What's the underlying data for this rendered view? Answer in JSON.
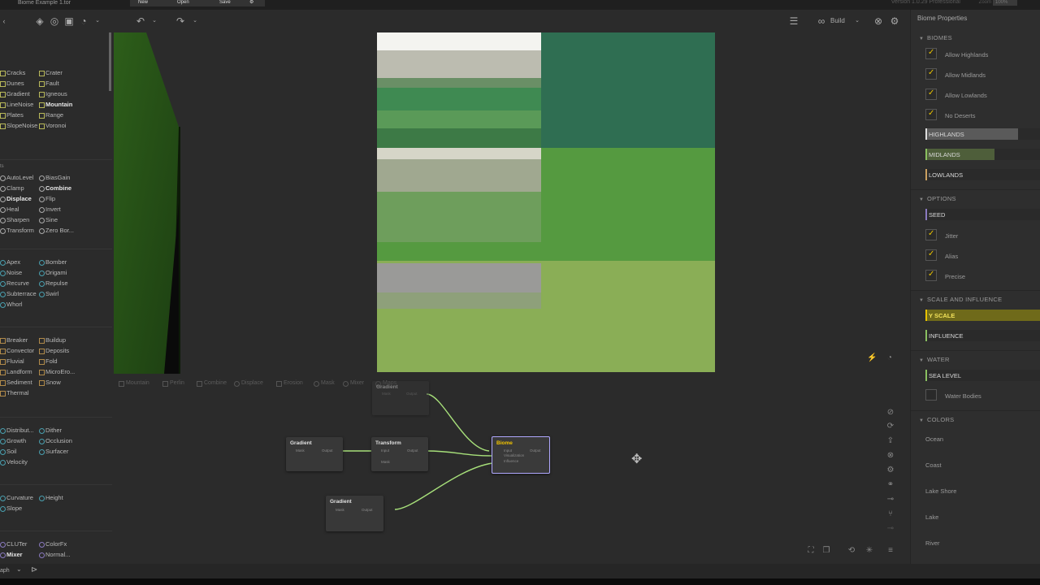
{
  "titlebar": {
    "document_tab": "Biome Example 1.tor",
    "menu": {
      "new": "New",
      "open": "Open",
      "save": "Save"
    },
    "version": "Version 1.0.29 Professional",
    "zoom_label": "Zoom",
    "zoom_value": "100%"
  },
  "toolbar": {
    "build_label": "Build"
  },
  "library": {
    "sections": [
      {
        "header": "",
        "items": [
          {
            "label": "Cracks",
            "style": "sq-y"
          },
          {
            "label": "Crater",
            "style": "sq-y"
          },
          {
            "label": "Dunes",
            "style": "sq-y"
          },
          {
            "label": "Fault",
            "style": "sq-y"
          },
          {
            "label": "Gradient",
            "style": "sq-y"
          },
          {
            "label": "Igneous",
            "style": "sq-y"
          },
          {
            "label": "LineNoise",
            "style": "sq-y"
          },
          {
            "label": "Mountain",
            "style": "sq-y",
            "bold": true
          },
          {
            "label": "Plates",
            "style": "sq-y"
          },
          {
            "label": "Range",
            "style": "sq-y"
          },
          {
            "label": "SlopeNoise",
            "style": "sq-y"
          },
          {
            "label": "Voronoi",
            "style": "sq-y"
          }
        ]
      },
      {
        "header": "ts",
        "items": [
          {
            "label": "AutoLevel",
            "style": "sl-w"
          },
          {
            "label": "BiasGain",
            "style": "sl-w"
          },
          {
            "label": "Clamp",
            "style": "sl-w"
          },
          {
            "label": "Combine",
            "style": "sl-w",
            "bold": true
          },
          {
            "label": "Displace",
            "style": "sl-w",
            "bold": true
          },
          {
            "label": "Flip",
            "style": "sl-w"
          },
          {
            "label": "Heal",
            "style": "sl-w"
          },
          {
            "label": "Invert",
            "style": "sl-w"
          },
          {
            "label": "Sharpen",
            "style": "sl-w"
          },
          {
            "label": "Sine",
            "style": "sl-w"
          },
          {
            "label": "Transform",
            "style": "sl-w"
          },
          {
            "label": "Zero Bor...",
            "style": "sl-w"
          }
        ]
      },
      {
        "header": "",
        "items": [
          {
            "label": "Apex",
            "style": "ci-b"
          },
          {
            "label": "Bomber",
            "style": "ci-b"
          },
          {
            "label": "Noise",
            "style": "ci-b"
          },
          {
            "label": "Origami",
            "style": "ci-b"
          },
          {
            "label": "Recurve",
            "style": "ci-b"
          },
          {
            "label": "Repulse",
            "style": "ci-b"
          },
          {
            "label": "Subterrace",
            "style": "ci-b"
          },
          {
            "label": "Swirl",
            "style": "ci-b"
          },
          {
            "label": "Whorl",
            "style": "ci-b"
          }
        ]
      },
      {
        "header": "",
        "items": [
          {
            "label": "Breaker",
            "style": "sq-o"
          },
          {
            "label": "Buildup",
            "style": "sq-o"
          },
          {
            "label": "Convector",
            "style": "sq-o"
          },
          {
            "label": "Deposits",
            "style": "sq-o"
          },
          {
            "label": "Fluvial",
            "style": "sq-o"
          },
          {
            "label": "Fold",
            "style": "sq-o"
          },
          {
            "label": "Landform",
            "style": "sq-o"
          },
          {
            "label": "MicroEro...",
            "style": "sq-o"
          },
          {
            "label": "Sediment",
            "style": "sq-o"
          },
          {
            "label": "Snow",
            "style": "sq-o"
          },
          {
            "label": "Thermal",
            "style": "sq-o"
          }
        ]
      },
      {
        "header": "",
        "items": [
          {
            "label": "Distribut...",
            "style": "ci-b"
          },
          {
            "label": "Dither",
            "style": "ci-b"
          },
          {
            "label": "Growth",
            "style": "ci-b"
          },
          {
            "label": "Occlusion",
            "style": "ci-b"
          },
          {
            "label": "Soil",
            "style": "ci-b"
          },
          {
            "label": "Surfacer",
            "style": "ci-b"
          },
          {
            "label": "Velocity",
            "style": "ci-b"
          }
        ]
      },
      {
        "header": "",
        "items": [
          {
            "label": "Curvature",
            "style": "ci-b"
          },
          {
            "label": "Height",
            "style": "ci-b"
          },
          {
            "label": "Slope",
            "style": "ci-b"
          }
        ]
      },
      {
        "header": "",
        "items": [
          {
            "label": "CLUTer",
            "style": "ci-p"
          },
          {
            "label": "ColorFx",
            "style": "ci-p"
          },
          {
            "label": "Mixer",
            "style": "ci-p",
            "bold": true
          },
          {
            "label": "Normal...",
            "style": "ci-p"
          }
        ]
      }
    ]
  },
  "graph": {
    "filters": [
      "Mountain",
      "Perlin",
      "Combine",
      "Displace",
      "Erosion",
      "Mask",
      "Mixer",
      "Maps"
    ],
    "nodes": {
      "gradient_top": {
        "title": "Gradient",
        "in": "Mask",
        "out": "Output"
      },
      "gradient_left": {
        "title": "Gradient",
        "in": "Mask",
        "out": "Output"
      },
      "transform": {
        "title": "Transform",
        "in": "Input",
        "in2": "Mask",
        "out": "Output"
      },
      "biome": {
        "title": "Biome",
        "in": "Input",
        "in2": "Visualization",
        "in3": "Influence",
        "out": "Output"
      },
      "gradient_bottom": {
        "title": "Gradient",
        "in": "Mask",
        "out": "Output"
      }
    },
    "bottom_label": "aph"
  },
  "props": {
    "title": "Biome Properties",
    "sections": {
      "biomes": "BIOMES",
      "options": "OPTIONS",
      "scale": "SCALE AND INFLUENCE",
      "water": "WATER",
      "colors": "COLORS"
    },
    "biomes_checks": [
      {
        "label": "Allow Highlands",
        "on": true
      },
      {
        "label": "Allow Midlands",
        "on": true
      },
      {
        "label": "Allow Lowlands",
        "on": true
      },
      {
        "label": "No Deserts",
        "on": true
      }
    ],
    "sliders": {
      "highlands": {
        "label": "HIGHLANDS",
        "level": 0.8
      },
      "midlands": {
        "label": "MIDLANDS",
        "level": 0.6
      },
      "lowlands": {
        "label": "LOWLANDS",
        "level": 0.01
      },
      "seed": {
        "label": "SEED",
        "level": 0.01
      },
      "y_scale": {
        "label": "Y SCALE",
        "level": 1.0
      },
      "influence": {
        "label": "INFLUENCE",
        "level": 0.01
      },
      "sea_level": {
        "label": "SEA LEVEL",
        "level": 0.01
      }
    },
    "options_checks": [
      {
        "label": "Jitter",
        "on": true
      },
      {
        "label": "Alias",
        "on": true
      },
      {
        "label": "Precise",
        "on": true
      }
    ],
    "water_bodies": {
      "label": "Water Bodies",
      "on": false
    },
    "colors": [
      "Ocean",
      "Coast",
      "Lake Shore",
      "Lake",
      "River"
    ]
  },
  "palette": {
    "accent_yellow": "#e8c200",
    "slider_highlands": "#5a5a5a",
    "slider_midlands": "#4e5e3a",
    "slider_yscale": "#6f6a1a",
    "graph_link": "#a7e07a",
    "node_selected": "#b0a8ff"
  }
}
